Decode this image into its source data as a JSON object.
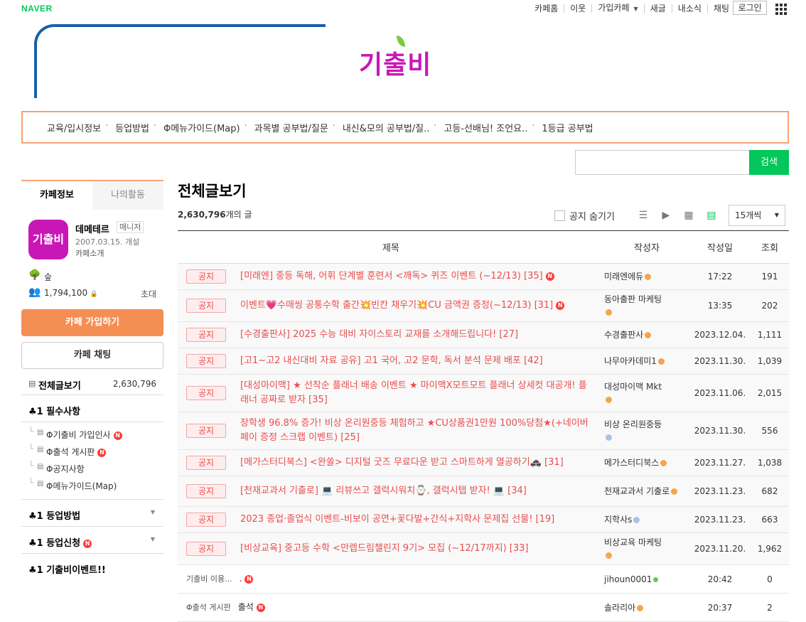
{
  "gnb": {
    "logo": "NAVER",
    "menu": [
      "카페홈",
      "이웃",
      "가입카페",
      "새글",
      "내소식",
      "채팅"
    ],
    "login": "로그인"
  },
  "banner": {
    "brand": "기출비"
  },
  "topnav": [
    "교육/입시정보",
    "등업방법",
    "Φ메뉴가이드(Map)",
    "과목별 공부법/질문",
    "내신&모의 공부법/질..",
    "고등-선배님! 조언요..",
    "1등급 공부법"
  ],
  "search": {
    "button": "검색",
    "placeholder": ""
  },
  "sidebar": {
    "tab_info": "카페정보",
    "tab_activity": "나의활동",
    "avatar_text": "기출비",
    "cafe_name": "데메테르",
    "manager_badge": "매니저",
    "created": "2007.03.15. 개설",
    "intro": "카페소개",
    "rank": "숲",
    "members": "1,794,100",
    "invite": "초대",
    "join": "카페 가입하기",
    "chat": "카페 채팅",
    "all_posts": "전체글보기",
    "all_posts_count": "2,630,796",
    "groups": [
      {
        "label": "♣1 필수사항"
      },
      {
        "label": "♣1 등업방법"
      },
      {
        "label": "♣1 등업신청"
      },
      {
        "label": "♣1 기출비이벤트!!"
      }
    ],
    "sub_items": [
      "Φ기출비 가입인사",
      "Φ출석 게시판",
      "Φ공지사항",
      "Φ메뉴가이드(Map)"
    ]
  },
  "main": {
    "title": "전체글보기",
    "count_num": "2,630,796",
    "count_suffix": "개의 글",
    "hide_notice": "공지 숨기기",
    "per_page": "15개씩",
    "headers": {
      "title": "제목",
      "author": "작성자",
      "date": "작성일",
      "views": "조회"
    },
    "notice_label": "공지",
    "notices": [
      {
        "title": "[미래엔] 중등 독해, 어휘 단계별 훈련서 <깨독> 퀴즈 이벤트 (~12/13) [35]",
        "author": "미래엔에듀",
        "date": "17:22",
        "views": "191",
        "new": true
      },
      {
        "title": "이벤트💗수매씽 공통수학 출간💥빈칸 채우기💥CU 금액권 증정(~12/13) [31]",
        "author": "동아출판 마케팅",
        "date": "13:35",
        "views": "202",
        "new": true
      },
      {
        "title": "[수경출판사] 2025 수능 대비 자이스토리 교재를 소개해드립니다! [27]",
        "author": "수경출판사",
        "date": "2023.12.04.",
        "views": "1,111",
        "new": false
      },
      {
        "title": "[고1~고2 내신대비 자료 공유] 고1 국어, 고2 문학, 독서 분석 문제 배포 [42]",
        "author": "나무아카데미1",
        "date": "2023.11.30.",
        "views": "1,039",
        "new": false
      },
      {
        "title": "[대성마이맥] ★ 선착순 플래너 배송 이벤트 ★ 마이맥X모트모트 플래너 상세컷 대공개! 플래너 공짜로 받자 [35]",
        "author": "대성마이맥 Mkt",
        "date": "2023.11.06.",
        "views": "2,015",
        "new": false
      },
      {
        "title": "장학생 96.8% 증가! 비상 온리원중등 체험하고 ★CU상품권1만원 100%당첨★(+네이버페이 증정 스크랩 이벤트) [25]",
        "author": "비상 온리원중등",
        "date": "2023.11.30.",
        "views": "556",
        "new": false
      },
      {
        "title": "[메가스터디북스] <완쏠> 디지털 굿즈 무료다운 받고 스마트하게 열공하기🚓 [31]",
        "author": "메가스터디북스",
        "date": "2023.11.27.",
        "views": "1,038",
        "new": false
      },
      {
        "title": "[천재교과서 기출로] 💻 리뷰쓰고 갤럭시워치⌚, 갤럭시탭 받자! 💻 [34]",
        "author": "천재교과서 기출로",
        "date": "2023.11.23.",
        "views": "682",
        "new": false
      },
      {
        "title": "2023 종업·졸업식 이벤트-비보이 공연+꽃다발+간식+지학사 문제집 선물! [19]",
        "author": "지학사s",
        "date": "2023.11.23.",
        "views": "663",
        "new": false
      },
      {
        "title": "[비상교육] 중고등 수학 <만렙드림챌린지 9기> 모집 (~12/17까지) [33]",
        "author": "비상교육 마케팅",
        "date": "2023.11.20.",
        "views": "1,962",
        "new": false
      }
    ],
    "posts": [
      {
        "board": "기출비 이용...",
        "title": ".",
        "author": "jihoun0001",
        "date": "20:42",
        "views": "0"
      },
      {
        "board": "Φ출석 게시판",
        "title": "출석",
        "author": "솔라리아",
        "date": "20:37",
        "views": "2"
      }
    ]
  }
}
